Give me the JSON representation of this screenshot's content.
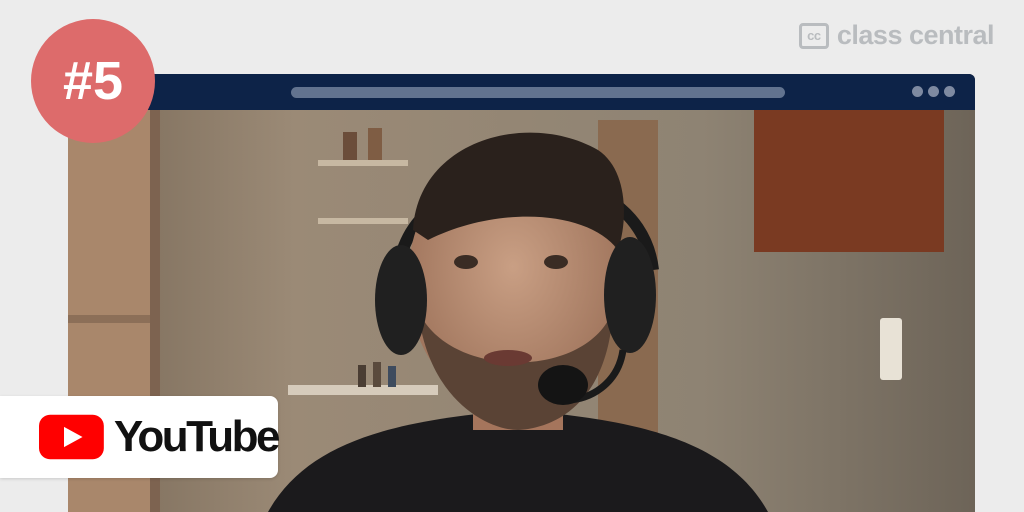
{
  "brand": {
    "icon": "cc",
    "name": "class central"
  },
  "badge": {
    "label": "#5"
  },
  "platform": {
    "name": "YouTube",
    "logo_color": "#ff0000",
    "icon": "youtube-play-icon"
  },
  "colors": {
    "background": "#ececec",
    "badge": "#dd6b6b",
    "window_bar": "#0d2348",
    "brand_text": "#b9bcbf"
  }
}
